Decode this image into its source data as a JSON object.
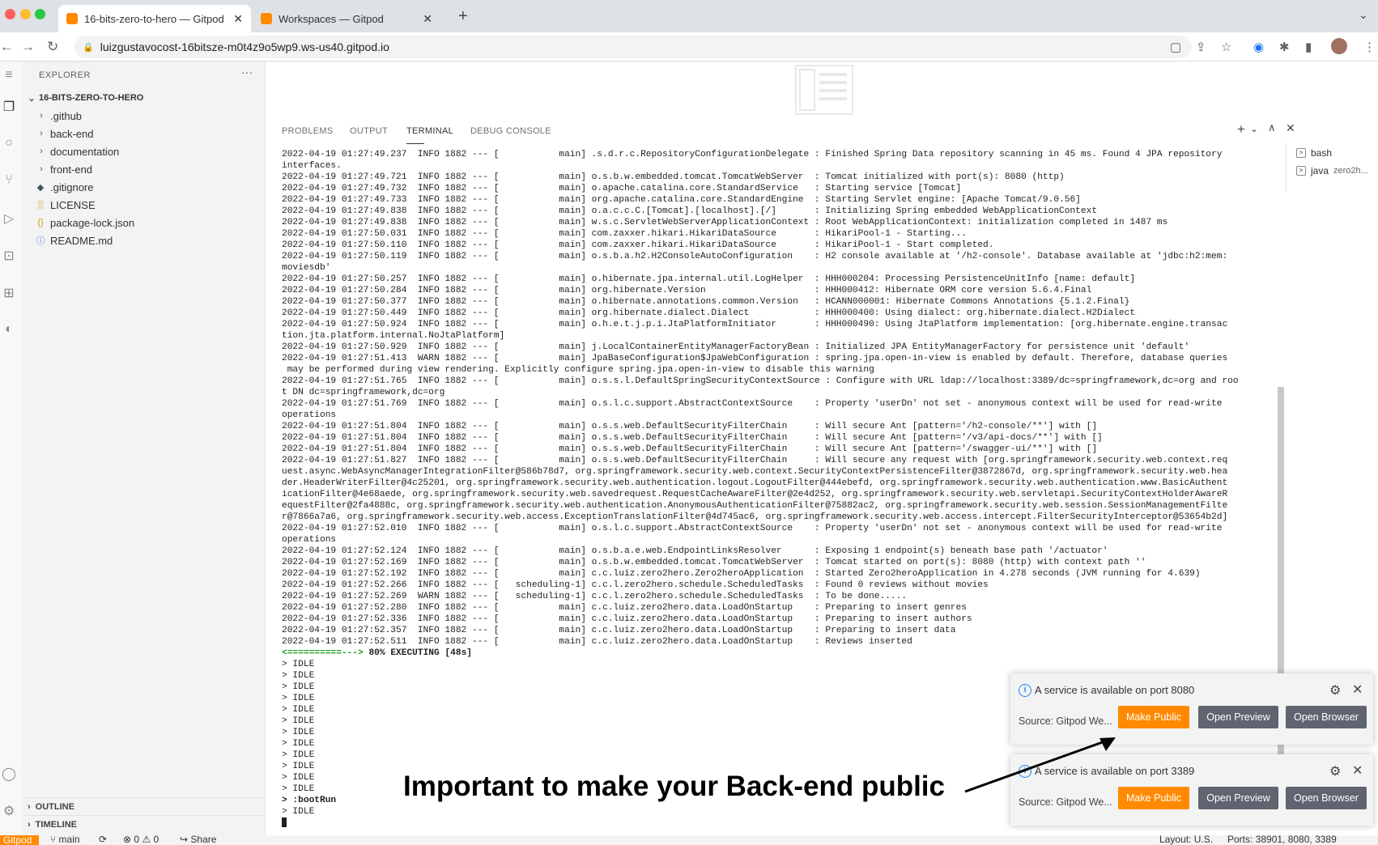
{
  "browser": {
    "tabs": [
      {
        "title": "16-bits-zero-to-hero — Gitpod",
        "active": true
      },
      {
        "title": "Workspaces — Gitpod",
        "active": false
      }
    ],
    "url": "luizgustavocost-16bitsze-m0t4z9o5wp9.ws-us40.gitpod.io"
  },
  "explorer": {
    "title": "EXPLORER",
    "more": "···",
    "root": "16-BITS-ZERO-TO-HERO",
    "items": [
      {
        "label": ".github",
        "type": "folder"
      },
      {
        "label": "back-end",
        "type": "folder"
      },
      {
        "label": "documentation",
        "type": "folder"
      },
      {
        "label": "front-end",
        "type": "folder"
      },
      {
        "label": ".gitignore",
        "type": "file",
        "icon": "◆"
      },
      {
        "label": "LICENSE",
        "type": "file",
        "icon": "🎗"
      },
      {
        "label": "package-lock.json",
        "type": "file",
        "icon": "{}"
      },
      {
        "label": "README.md",
        "type": "file",
        "icon": "ⓘ"
      }
    ],
    "outline": "OUTLINE",
    "timeline": "TIMELINE"
  },
  "panel": {
    "tabs": [
      "PROBLEMS",
      "OUTPUT",
      "TERMINAL",
      "DEBUG CONSOLE"
    ],
    "active_tab": "TERMINAL"
  },
  "terminals": [
    {
      "name": "bash",
      "detail": ""
    },
    {
      "name": "java",
      "detail": "zero2h..."
    }
  ],
  "terminal_lines": [
    "2022-04-19 01:27:49.237  INFO 1882 --- [           main] .s.d.r.c.RepositoryConfigurationDelegate : Finished Spring Data repository scanning in 45 ms. Found 4 JPA repository",
    "interfaces.",
    "2022-04-19 01:27:49.721  INFO 1882 --- [           main] o.s.b.w.embedded.tomcat.TomcatWebServer  : Tomcat initialized with port(s): 8080 (http)",
    "2022-04-19 01:27:49.732  INFO 1882 --- [           main] o.apache.catalina.core.StandardService   : Starting service [Tomcat]",
    "2022-04-19 01:27:49.733  INFO 1882 --- [           main] org.apache.catalina.core.StandardEngine  : Starting Servlet engine: [Apache Tomcat/9.0.56]",
    "2022-04-19 01:27:49.838  INFO 1882 --- [           main] o.a.c.c.C.[Tomcat].[localhost].[/]       : Initializing Spring embedded WebApplicationContext",
    "2022-04-19 01:27:49.838  INFO 1882 --- [           main] w.s.c.ServletWebServerApplicationContext : Root WebApplicationContext: initialization completed in 1487 ms",
    "2022-04-19 01:27:50.031  INFO 1882 --- [           main] com.zaxxer.hikari.HikariDataSource       : HikariPool-1 - Starting...",
    "2022-04-19 01:27:50.110  INFO 1882 --- [           main] com.zaxxer.hikari.HikariDataSource       : HikariPool-1 - Start completed.",
    "2022-04-19 01:27:50.119  INFO 1882 --- [           main] o.s.b.a.h2.H2ConsoleAutoConfiguration    : H2 console available at '/h2-console'. Database available at 'jdbc:h2:mem:",
    "moviesdb'",
    "2022-04-19 01:27:50.257  INFO 1882 --- [           main] o.hibernate.jpa.internal.util.LogHelper  : HHH000204: Processing PersistenceUnitInfo [name: default]",
    "2022-04-19 01:27:50.284  INFO 1882 --- [           main] org.hibernate.Version                    : HHH000412: Hibernate ORM core version 5.6.4.Final",
    "2022-04-19 01:27:50.377  INFO 1882 --- [           main] o.hibernate.annotations.common.Version   : HCANN000001: Hibernate Commons Annotations {5.1.2.Final}",
    "2022-04-19 01:27:50.449  INFO 1882 --- [           main] org.hibernate.dialect.Dialect            : HHH000400: Using dialect: org.hibernate.dialect.H2Dialect",
    "2022-04-19 01:27:50.924  INFO 1882 --- [           main] o.h.e.t.j.p.i.JtaPlatformInitiator       : HHH000490: Using JtaPlatform implementation: [org.hibernate.engine.transac",
    "tion.jta.platform.internal.NoJtaPlatform]",
    "2022-04-19 01:27:50.929  INFO 1882 --- [           main] j.LocalContainerEntityManagerFactoryBean : Initialized JPA EntityManagerFactory for persistence unit 'default'",
    "2022-04-19 01:27:51.413  WARN 1882 --- [           main] JpaBaseConfiguration$JpaWebConfiguration : spring.jpa.open-in-view is enabled by default. Therefore, database queries",
    " may be performed during view rendering. Explicitly configure spring.jpa.open-in-view to disable this warning",
    "2022-04-19 01:27:51.765  INFO 1882 --- [           main] o.s.s.l.DefaultSpringSecurityContextSource : Configure with URL ldap://localhost:3389/dc=springframework,dc=org and roo",
    "t DN dc=springframework,dc=org",
    "2022-04-19 01:27:51.769  INFO 1882 --- [           main] o.s.l.c.support.AbstractContextSource    : Property 'userDn' not set - anonymous context will be used for read-write",
    "operations",
    "2022-04-19 01:27:51.804  INFO 1882 --- [           main] o.s.s.web.DefaultSecurityFilterChain     : Will secure Ant [pattern='/h2-console/**'] with []",
    "2022-04-19 01:27:51.804  INFO 1882 --- [           main] o.s.s.web.DefaultSecurityFilterChain     : Will secure Ant [pattern='/v3/api-docs/**'] with []",
    "2022-04-19 01:27:51.804  INFO 1882 --- [           main] o.s.s.web.DefaultSecurityFilterChain     : Will secure Ant [pattern='/swagger-ui/**'] with []",
    "2022-04-19 01:27:51.827  INFO 1882 --- [           main] o.s.s.web.DefaultSecurityFilterChain     : Will secure any request with [org.springframework.security.web.context.req",
    "uest.async.WebAsyncManagerIntegrationFilter@586b78d7, org.springframework.security.web.context.SecurityContextPersistenceFilter@3872867d, org.springframework.security.web.hea",
    "der.HeaderWriterFilter@4c25201, org.springframework.security.web.authentication.logout.LogoutFilter@444ebefd, org.springframework.security.web.authentication.www.BasicAuthent",
    "icationFilter@4e68aede, org.springframework.security.web.savedrequest.RequestCacheAwareFilter@2e4d252, org.springframework.security.web.servletapi.SecurityContextHolderAwareR",
    "equestFilter@2fa4888c, org.springframework.security.web.authentication.AnonymousAuthenticationFilter@75882ac2, org.springframework.security.web.session.SessionManagementFilte",
    "r@7866a7a6, org.springframework.security.web.access.ExceptionTranslationFilter@4d745ac6, org.springframework.security.web.access.intercept.FilterSecurityInterceptor@53654b2d]",
    "2022-04-19 01:27:52.010  INFO 1882 --- [           main] o.s.l.c.support.AbstractContextSource    : Property 'userDn' not set - anonymous context will be used for read-write",
    "operations",
    "2022-04-19 01:27:52.124  INFO 1882 --- [           main] o.s.b.a.e.web.EndpointLinksResolver      : Exposing 1 endpoint(s) beneath base path '/actuator'",
    "2022-04-19 01:27:52.169  INFO 1882 --- [           main] o.s.b.w.embedded.tomcat.TomcatWebServer  : Tomcat started on port(s): 8080 (http) with context path ''",
    "2022-04-19 01:27:52.192  INFO 1882 --- [           main] c.c.luiz.zero2hero.Zero2heroApplication  : Started Zero2heroApplication in 4.278 seconds (JVM running for 4.639)",
    "2022-04-19 01:27:52.266  INFO 1882 --- [   scheduling-1] c.c.l.zero2hero.schedule.ScheduledTasks  : Found 0 reviews without movies",
    "2022-04-19 01:27:52.269  WARN 1882 --- [   scheduling-1] c.c.l.zero2hero.schedule.ScheduledTasks  : To be done.....",
    "2022-04-19 01:27:52.280  INFO 1882 --- [           main] c.c.luiz.zero2hero.data.LoadOnStartup    : Preparing to insert genres",
    "2022-04-19 01:27:52.336  INFO 1882 --- [           main] c.c.luiz.zero2hero.data.LoadOnStartup    : Preparing to insert authors",
    "2022-04-19 01:27:52.357  INFO 1882 --- [           main] c.c.luiz.zero2hero.data.LoadOnStartup    : Preparing to insert data",
    "2022-04-19 01:27:52.511  INFO 1882 --- [           main] c.c.luiz.zero2hero.data.LoadOnStartup    : Reviews inserted"
  ],
  "progress": {
    "bar": "<==========--->",
    "percent": "80%",
    "status": "EXECUTING [48s]",
    "fraction": 0.8
  },
  "idle_lines": [
    "> IDLE",
    "> IDLE",
    "> IDLE",
    "> IDLE",
    "> IDLE",
    "> IDLE",
    "> IDLE",
    "> IDLE",
    "> IDLE",
    "> IDLE",
    "> IDLE",
    "> IDLE"
  ],
  "bootrun_line": "> :bootRun",
  "last_idle": "> IDLE",
  "notifications": [
    {
      "message": "A service is available on port 8080",
      "source": "Source: Gitpod We...",
      "make_public": "Make Public",
      "open_preview": "Open Preview",
      "open_browser": "Open Browser"
    },
    {
      "message": "A service is available on port 3389",
      "source": "Source: Gitpod We...",
      "make_public": "Make Public",
      "open_preview": "Open Preview",
      "open_browser": "Open Browser"
    }
  ],
  "annotation": "Important to make your Back-end public",
  "statusbar": {
    "gitpod": "Gitpod",
    "branch": "main",
    "problems": "⊗ 0 ⚠ 0",
    "share": "Share",
    "layout": "Layout: U.S.",
    "ports": "Ports: 38901, 8080, 3389"
  },
  "colors": {
    "accent": "#ff8a00",
    "button_secondary": "#5f6470",
    "info": "#1a85ff"
  }
}
